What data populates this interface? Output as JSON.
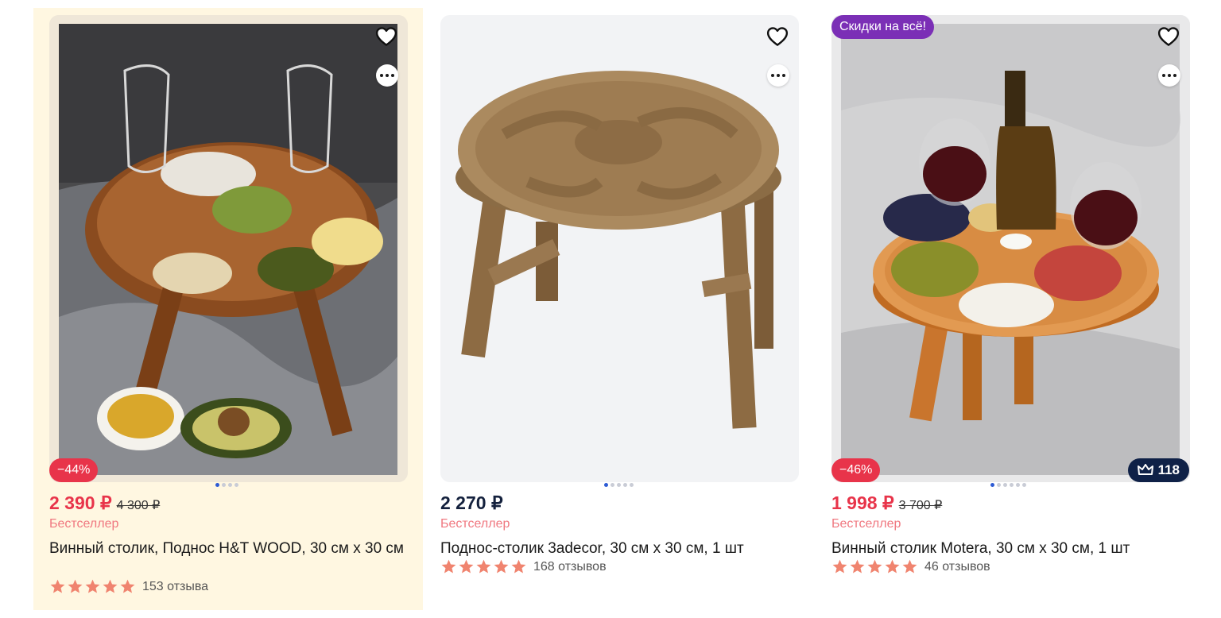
{
  "colors": {
    "sale_price": "#e8344a",
    "regular_price": "#14213d",
    "discount_badge": "#e8344a",
    "promo_badge": "#7b2fb6",
    "rating_badge": "#0f2147",
    "star": "#f0846f",
    "bestseller": "#f07880",
    "highlight_bg": "#fff7e1"
  },
  "products": [
    {
      "discount": "−44%",
      "price": "2 390 ₽",
      "old_price": "4 300 ₽",
      "label": "Бестселлер",
      "title": "Винный столик, Поднос H&T WOOD, 30 см х 30 см",
      "rating_stars": 5,
      "reviews": "153 отзыва",
      "image_dots": 4,
      "active_dot": 0,
      "icons": [
        "heart-icon",
        "more-icon",
        "star-icon"
      ]
    },
    {
      "price": "2 270 ₽",
      "label": "Бестселлер",
      "title": "Поднос-столик 3adecor, 30 см х 30 см, 1 шт",
      "rating_stars": 5,
      "reviews": "168 отзывов",
      "image_dots": 5,
      "active_dot": 0
    },
    {
      "promo": "Скидки на всё!",
      "discount": "−46%",
      "price": "1 998 ₽",
      "old_price": "3 700 ₽",
      "label": "Бестселлер",
      "title": "Винный столик Motera, 30 см х 30 см, 1 шт",
      "rating_stars": 5,
      "reviews": "46 отзывов",
      "badge_count": "118",
      "badge_icon": "crown-icon",
      "image_dots": 6,
      "active_dot": 0
    }
  ]
}
